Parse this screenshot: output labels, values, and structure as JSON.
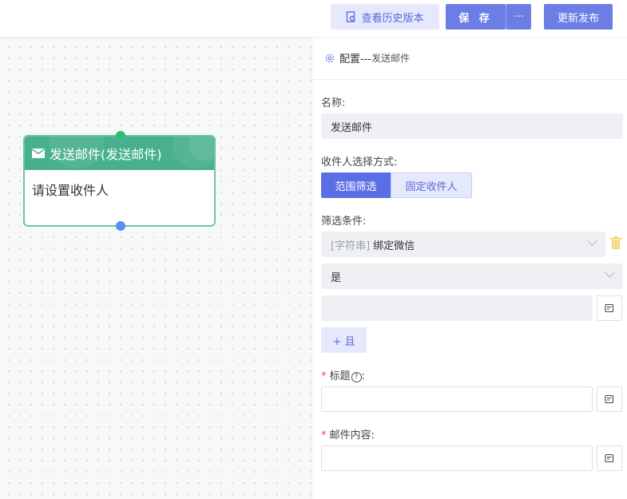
{
  "toolbar": {
    "history_label": "查看历史版本",
    "save_label": "保 存",
    "more_label": "···",
    "publish_label": "更新发布"
  },
  "node": {
    "title": "发送邮件(发送邮件)",
    "body": "请设置收件人",
    "icon": "mail-icon",
    "color": "#48b08d"
  },
  "panel": {
    "title": "配置---",
    "subtitle": "发送邮件",
    "name_label": "名称:",
    "name_value": "发送邮件",
    "recipient_label": "收件人选择方式:",
    "recipient_options": [
      "范围筛选",
      "固定收件人"
    ],
    "recipient_selected": "范围筛选",
    "filter_label": "筛选条件:",
    "filter_field_type": "[字符串]",
    "filter_field_name": "绑定微信",
    "filter_operator": "是",
    "filter_value": "",
    "add_and_label": "+ 且",
    "subject_label": "标题",
    "subject_colon": ":",
    "subject_value": "",
    "content_label": "邮件内容:",
    "content_value": ""
  },
  "colors": {
    "accent": "#6c7ee6",
    "node_green": "#48b08d",
    "required": "#e74c3c"
  }
}
